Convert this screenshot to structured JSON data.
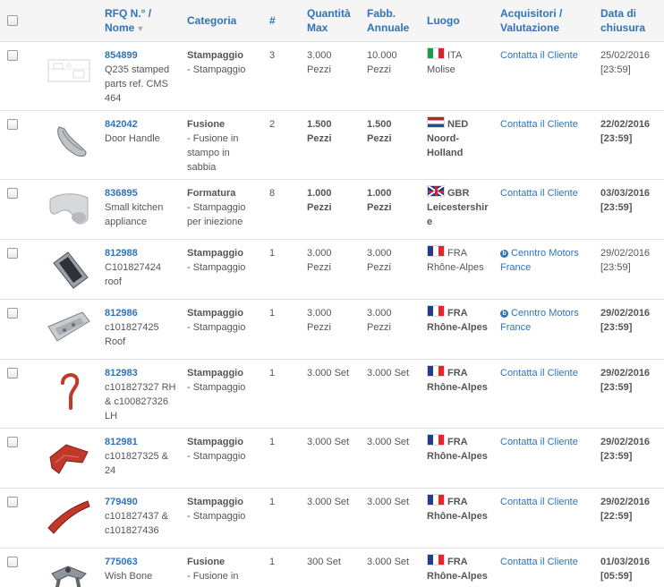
{
  "header": {
    "rfq_line1": "RFQ N.° /",
    "rfq_line2": "Nome",
    "category": "Categoria",
    "hash": "#",
    "qty_line1": "Quantità",
    "qty_line2": "Max",
    "annual_line1": "Fabb.",
    "annual_line2": "Annuale",
    "place": "Luogo",
    "buyers_line1": "Acquisitori /",
    "buyers_line2": "Valutazione",
    "close_line1": "Data di",
    "close_line2": "chiusura"
  },
  "rows": [
    {
      "id": "854899",
      "name": [
        "Q235 stamped",
        "parts ref. CMS",
        "464"
      ],
      "category": "Stampaggio",
      "subcategory": [
        "- Stampaggio"
      ],
      "count": "3",
      "qty": [
        "3.000",
        "Pezzi"
      ],
      "annual": [
        "10.000",
        "Pezzi"
      ],
      "country": "ITA",
      "region": [
        "Molise"
      ],
      "buyer": [
        "Contatta il Cliente"
      ],
      "date": "25/02/2016",
      "time": "[23:59]"
    },
    {
      "id": "842042",
      "name": [
        "Door Handle"
      ],
      "category": "Fusione",
      "subcategory": [
        "- Fusione in",
        "stampo in",
        "sabbia"
      ],
      "count": "2",
      "qty": [
        "1.500",
        "Pezzi"
      ],
      "annual": [
        "1.500",
        "Pezzi"
      ],
      "country": "NED",
      "region": [
        "Noord-",
        "Holland"
      ],
      "buyer": [
        "Contatta il Cliente"
      ],
      "date": "22/02/2016",
      "time": "[23:59]"
    },
    {
      "id": "836895",
      "name": [
        "Small kitchen",
        "appliance"
      ],
      "category": "Formatura",
      "subcategory": [
        "- Stampaggio",
        "per iniezione"
      ],
      "count": "8",
      "qty": [
        "1.000",
        "Pezzi"
      ],
      "annual": [
        "1.000",
        "Pezzi"
      ],
      "country": "GBR",
      "region": [
        "Leicestershir",
        "e"
      ],
      "buyer": [
        "Contatta il Cliente"
      ],
      "date": "03/03/2016",
      "time": "[23:59]"
    },
    {
      "id": "812988",
      "name": [
        "C101827424",
        "roof"
      ],
      "category": "Stampaggio",
      "subcategory": [
        "- Stampaggio"
      ],
      "count": "1",
      "qty": [
        "3.000",
        "Pezzi"
      ],
      "annual": [
        "3.000",
        "Pezzi"
      ],
      "country": "FRA",
      "region": [
        "Rhône-Alpes"
      ],
      "buyer": [
        "Cenntro Motors",
        "France"
      ],
      "date": "29/02/2016",
      "time": "[23:59]"
    },
    {
      "id": "812986",
      "name": [
        "c101827425",
        "Roof"
      ],
      "category": "Stampaggio",
      "subcategory": [
        "- Stampaggio"
      ],
      "count": "1",
      "qty": [
        "3.000",
        "Pezzi"
      ],
      "annual": [
        "3.000",
        "Pezzi"
      ],
      "country": "FRA",
      "region": [
        "Rhône-Alpes"
      ],
      "buyer": [
        "Cenntro Motors",
        "France"
      ],
      "date": "29/02/2016",
      "time": "[23:59]"
    },
    {
      "id": "812983",
      "name": [
        "c101827327 RH",
        "& c100827326",
        "LH"
      ],
      "category": "Stampaggio",
      "subcategory": [
        "- Stampaggio"
      ],
      "count": "1",
      "qty": [
        "3.000 Set"
      ],
      "annual": [
        "3.000 Set"
      ],
      "country": "FRA",
      "region": [
        "Rhône-Alpes"
      ],
      "buyer": [
        "Contatta il Cliente"
      ],
      "date": "29/02/2016",
      "time": "[23:59]"
    },
    {
      "id": "812981",
      "name": [
        "c101827325 &",
        "24"
      ],
      "category": "Stampaggio",
      "subcategory": [
        "- Stampaggio"
      ],
      "count": "1",
      "qty": [
        "3.000 Set"
      ],
      "annual": [
        "3.000 Set"
      ],
      "country": "FRA",
      "region": [
        "Rhône-Alpes"
      ],
      "buyer": [
        "Contatta il Cliente"
      ],
      "date": "29/02/2016",
      "time": "[23:59]"
    },
    {
      "id": "779490",
      "name": [
        "c101827437 &",
        "c101827436"
      ],
      "category": "Stampaggio",
      "subcategory": [
        "- Stampaggio"
      ],
      "count": "1",
      "qty": [
        "3.000 Set"
      ],
      "annual": [
        "3.000 Set"
      ],
      "country": "FRA",
      "region": [
        "Rhône-Alpes"
      ],
      "buyer": [
        "Contatta il Cliente"
      ],
      "date": "29/02/2016",
      "time": "[22:59]"
    },
    {
      "id": "775063",
      "name": [
        "Wish Bone"
      ],
      "category": "Fusione",
      "subcategory": [
        "- Fusione in"
      ],
      "count": "1",
      "qty": [
        "300 Set"
      ],
      "annual": [
        "3.000 Set"
      ],
      "country": "FRA",
      "region": [
        "Rhône-Alpes"
      ],
      "buyer": [
        "Contatta il Cliente"
      ],
      "date": "01/03/2016",
      "time": "[05:59]"
    }
  ],
  "colors": {
    "link": "#2f73ba",
    "text": "#555555",
    "header_bg": "#f5f5f5"
  },
  "icons": {
    "sort": "sort-desc-icon",
    "buyer_badge": "verified-buyer-icon",
    "checkbox": "checkbox"
  }
}
